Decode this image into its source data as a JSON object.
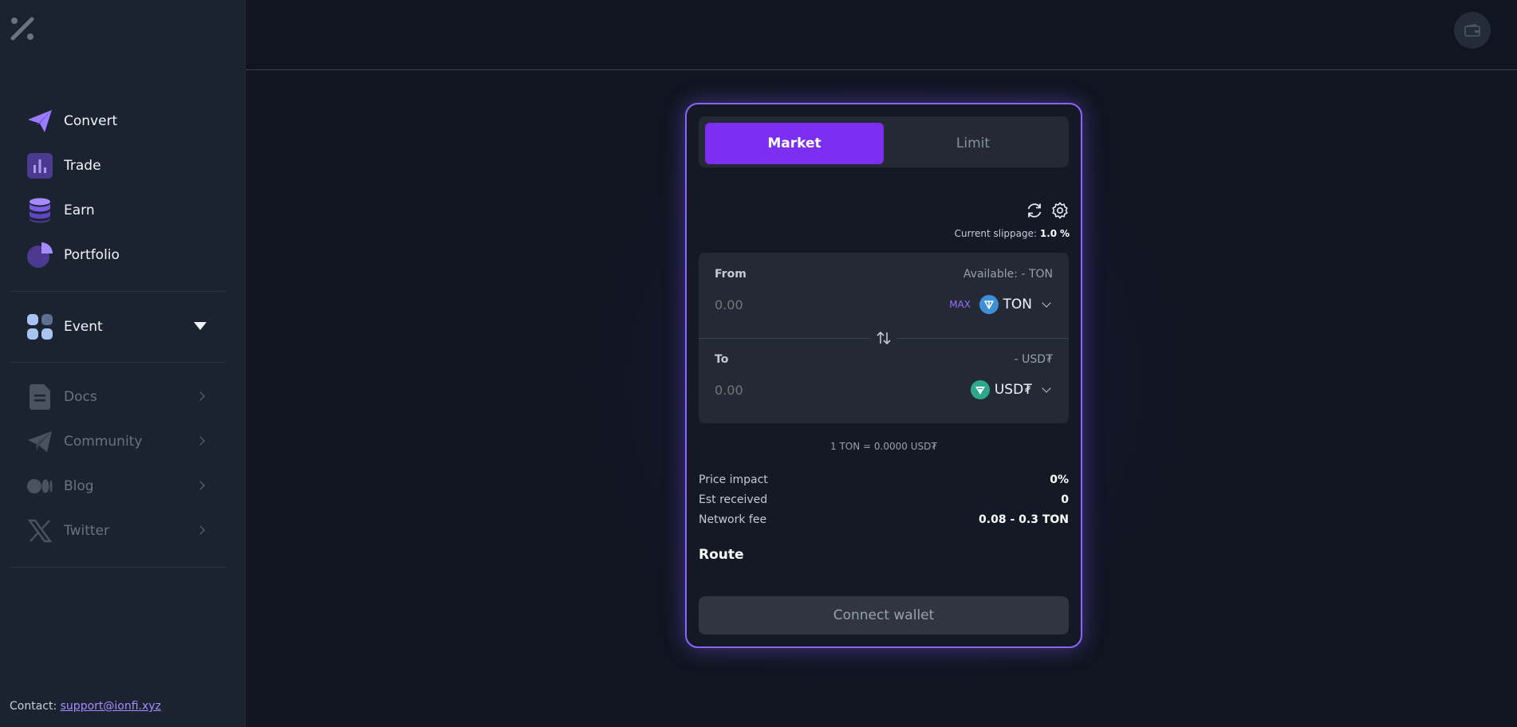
{
  "sidebar": {
    "main_items": [
      {
        "label": "Convert",
        "icon": "send-icon"
      },
      {
        "label": "Trade",
        "icon": "chart-bars-icon"
      },
      {
        "label": "Earn",
        "icon": "database-icon"
      },
      {
        "label": "Portfolio",
        "icon": "pie-chart-icon"
      }
    ],
    "event_label": "Event",
    "link_items": [
      {
        "label": "Docs",
        "icon": "document-icon"
      },
      {
        "label": "Community",
        "icon": "telegram-icon"
      },
      {
        "label": "Blog",
        "icon": "medium-icon"
      },
      {
        "label": "Twitter",
        "icon": "x-icon"
      }
    ],
    "contact_label": "Contact:",
    "contact_email": "support@ionfi.xyz"
  },
  "card": {
    "tabs": {
      "market": "Market",
      "limit": "Limit"
    },
    "slippage_label": "Current slippage:",
    "slippage_value": "1.0",
    "slippage_unit": "%",
    "from": {
      "label": "From",
      "available": "Available: - TON",
      "amount_placeholder": "0.00",
      "max_label": "MAX",
      "token": "TON"
    },
    "to": {
      "label": "To",
      "balance": "- USD₮",
      "amount_placeholder": "0.00",
      "token": "USD₮"
    },
    "rate": "1 TON = 0.0000 USD₮",
    "info": [
      {
        "key": "Price impact",
        "value": "0%"
      },
      {
        "key": "Est received",
        "value": "0"
      },
      {
        "key": "Network fee",
        "value": "0.08 - 0.3 TON"
      }
    ],
    "route_label": "Route",
    "connect_label": "Connect wallet"
  },
  "colors": {
    "accent": "#7c2ff0",
    "card_border": "#8e63ff",
    "ton_blue": "#3e8fd6",
    "usdt_green": "#2ea88c"
  }
}
